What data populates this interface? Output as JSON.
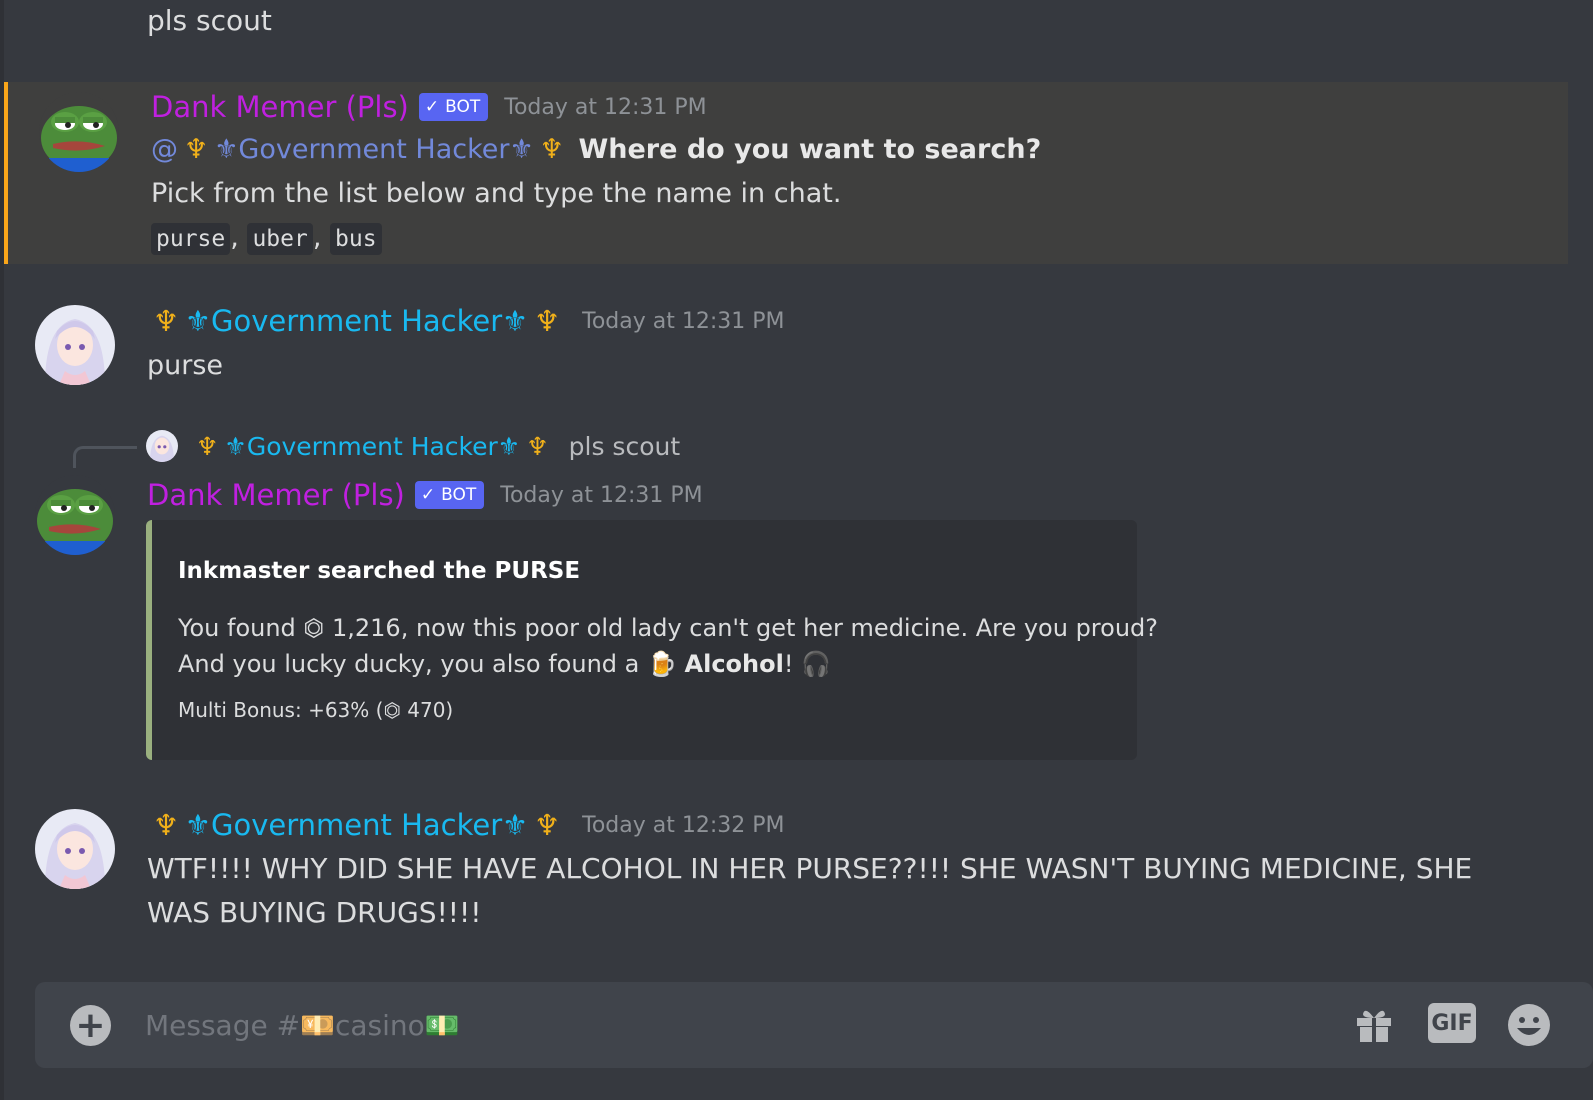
{
  "channel": {
    "input_placeholder": "Message #💴casino💵"
  },
  "messages": [
    {
      "id": "m0",
      "text": "pls scout"
    },
    {
      "id": "m1",
      "author": "Dank Memer (Pls)",
      "bot_tag": "BOT",
      "timestamp": "Today at 12:31 PM",
      "mention_prefix": "@",
      "mention_user": "⚜Government Hacker⚜",
      "mention_trident": "♆",
      "bold_text": "Where do you want to search?",
      "line2": "Pick from the list below and type the name in chat.",
      "options": [
        "purse",
        "uber",
        "bus"
      ],
      "separator": ","
    },
    {
      "id": "m2",
      "author": "⚜Government Hacker⚜",
      "author_trident": "♆",
      "timestamp": "Today at 12:31 PM",
      "text": "purse"
    },
    {
      "id": "m3",
      "reply_author": "⚜Government Hacker⚜",
      "reply_text": "pls scout",
      "author": "Dank Memer (Pls)",
      "bot_tag": "BOT",
      "timestamp": "Today at 12:31 PM",
      "embed": {
        "title": "Inkmaster searched the PURSE",
        "line1": "You found ⏣ 1,216, now this poor old lady can't get her medicine. Are you proud?",
        "line2_prefix": "And you lucky ducky, you also found a 🍺",
        "line2_bold": "Alcohol",
        "line2_suffix": "! 🎧",
        "footer": "Multi Bonus: +63% (⏣ 470)",
        "color": "#9ab07f"
      }
    },
    {
      "id": "m4",
      "author": "⚜Government Hacker⚜",
      "author_trident": "♆",
      "timestamp": "Today at 12:32 PM",
      "line1": "WTF!!!! WHY DID SHE HAVE ALCOHOL IN HER PURSE??!!! SHE WASN'T BUYING MEDICINE, SHE",
      "line2": "WAS BUYING DRUGS!!!!"
    }
  ],
  "toolbar": {
    "plus_icon": "+",
    "gif_label": "GIF"
  },
  "colors": {
    "background": "#36393f",
    "highlight_bg": "#3f3f3e",
    "highlight_border": "#faa61a",
    "bot_name": "#c020e0",
    "user_name": "#19b9f0",
    "bot_tag": "#5865f2",
    "mention": "#7289da"
  }
}
